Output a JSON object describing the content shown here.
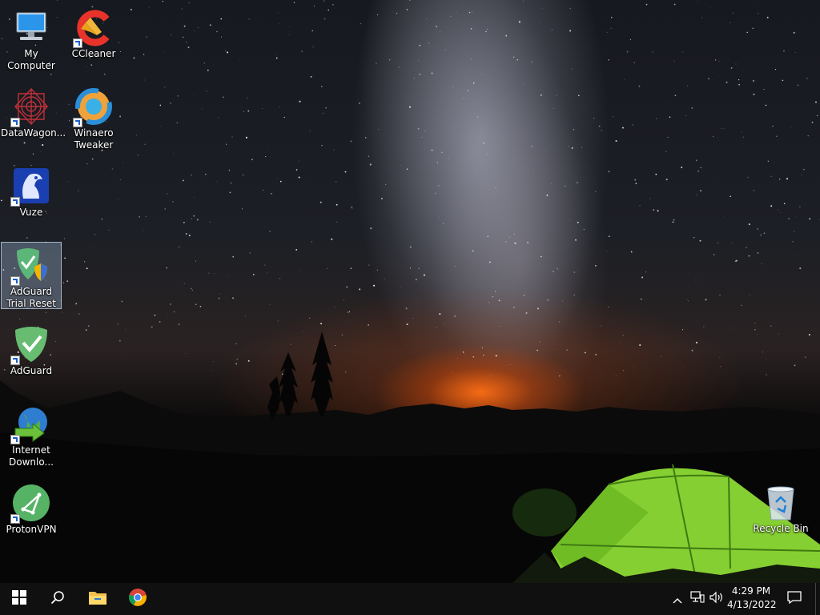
{
  "desktop": {
    "icons": [
      {
        "label": "My Computer",
        "icon": "computer-icon"
      },
      {
        "label": "CCleaner",
        "icon": "ccleaner-icon"
      },
      {
        "label": "DataWagon...",
        "icon": "datawagon-icon"
      },
      {
        "label": "Winaero Tweaker",
        "icon": "winaero-icon"
      },
      {
        "label": "Vuze",
        "icon": "vuze-frog-icon"
      },
      {
        "label": "AdGuard Trial Reset",
        "icon": "adguard-reset-icon",
        "selected": true
      },
      {
        "label": "AdGuard",
        "icon": "adguard-shield-icon"
      },
      {
        "label": "Internet Downlo...",
        "icon": "idm-globe-icon"
      },
      {
        "label": "ProtonVPN",
        "icon": "protonvpn-icon"
      },
      {
        "label": "Recycle Bin",
        "icon": "recycle-bin-icon"
      }
    ]
  },
  "taskbar": {
    "start": "windows-logo-icon",
    "search": "search-icon",
    "pinned": [
      "file-explorer-icon",
      "chrome-icon"
    ],
    "tray": [
      "chevron-up-icon",
      "network-icon",
      "volume-icon"
    ],
    "clock": {
      "time": "4:29 PM",
      "date": "4/13/2022"
    },
    "notifications": "action-center-icon"
  },
  "colors": {
    "taskbar": "#101010",
    "selection": "#a0bedc",
    "tent": "#8bd43a",
    "horizon": "#ff6e14"
  }
}
